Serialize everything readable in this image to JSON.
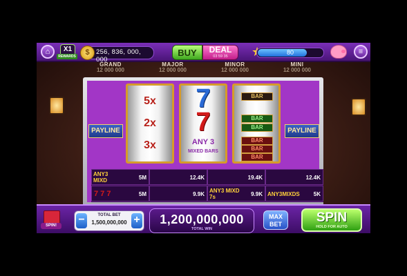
{
  "topbar": {
    "multiplier": "X1",
    "rewards_label": "REWARDS",
    "coins": "256, 836, 000, 000",
    "buy_label": "BUY",
    "deal_label": "DEAL",
    "deal_timer": "03 59 35",
    "level_value": "80",
    "level_progress": 0.75,
    "icons": [
      "home-icon",
      "coin-icon",
      "star-icon",
      "piggy-bank-icon",
      "menu-icon"
    ]
  },
  "jackpots": [
    {
      "label": "GRAND",
      "value": "12 000 000"
    },
    {
      "label": "MAJOR",
      "value": "12 000 000"
    },
    {
      "label": "MINOR",
      "value": "12 000 000"
    },
    {
      "label": "MINI",
      "value": "12 000 000"
    }
  ],
  "machine": {
    "payline_label": "PAYLINE",
    "reel1": [
      "5x",
      "2x",
      "3x"
    ],
    "reel2": [
      "7",
      "7",
      "ANY 3",
      "MIXED BARS"
    ],
    "reel3": [
      "BAR",
      "BAR",
      "BAR",
      "BAR",
      "BAR",
      "BAR"
    ]
  },
  "paytable": {
    "row1": [
      {
        "label": "ANY3 MIXD",
        "value": "5M"
      },
      {
        "label": "",
        "value": "12.4K"
      },
      {
        "label": "",
        "value": "19.4K"
      },
      {
        "label": "",
        "value": "12.4K"
      }
    ],
    "row2": [
      {
        "label": "",
        "value": "5M"
      },
      {
        "label": "",
        "value": "9.9K"
      },
      {
        "label": "ANY3 MIXD 7s",
        "value": "9.9K"
      },
      {
        "label": "ANY3MIXDS",
        "value": "5K"
      }
    ]
  },
  "bottombar": {
    "gift_label": "SPIN!",
    "total_bet_label": "TOTAL BET",
    "total_bet": "1,500,000,000",
    "minus": "−",
    "plus": "+",
    "total_win": "1,200,000,000",
    "total_win_label": "TOTAL WIN",
    "maxbet_line1": "MAX",
    "maxbet_line2": "BET",
    "spin_label": "SPIN",
    "spin_sub": "HOLD FOR AUTO"
  }
}
